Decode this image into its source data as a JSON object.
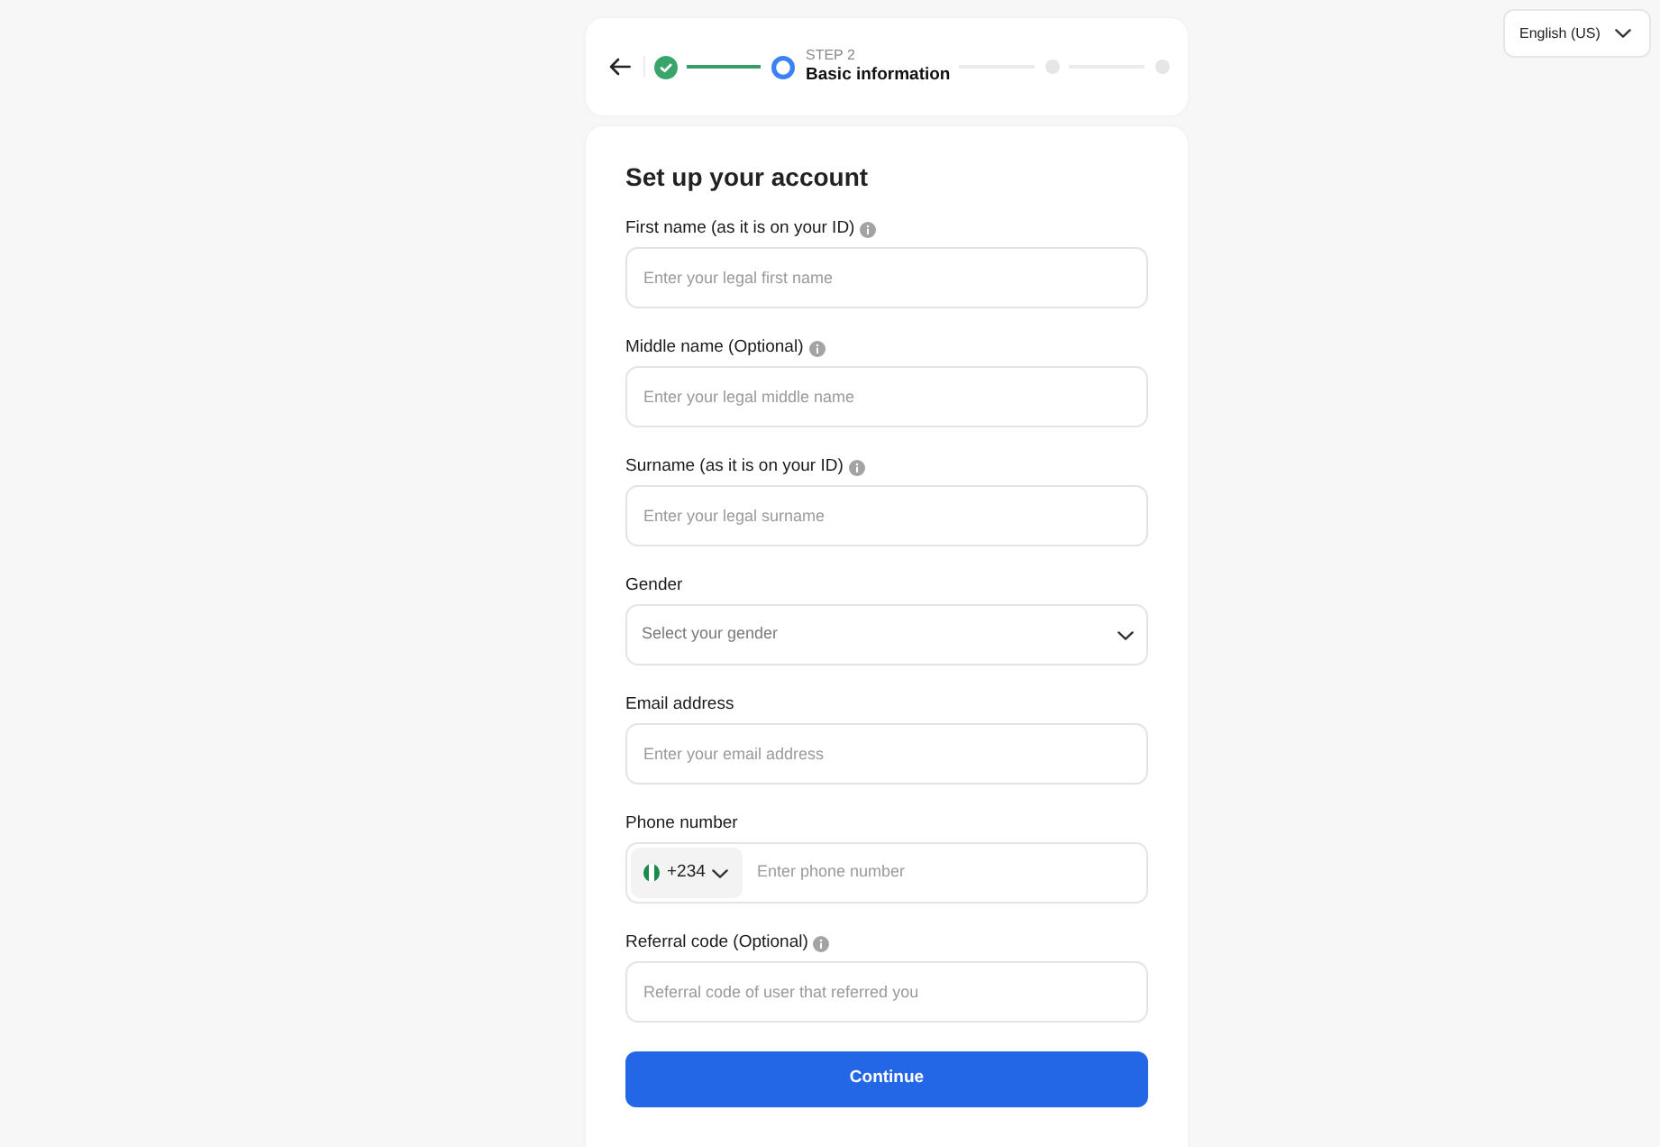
{
  "language_selector": {
    "label": "English (US)"
  },
  "stepper": {
    "steps": [
      {
        "completed": true,
        "current": false
      },
      {
        "completed": false,
        "current": true,
        "caption": "STEP 2",
        "title": "Basic information"
      },
      {
        "completed": false,
        "current": false
      },
      {
        "completed": false,
        "current": false
      }
    ]
  },
  "form": {
    "title": "Set up your account",
    "fields": [
      {
        "kind": "text",
        "label": "First name (as it is on your ID)",
        "info": true,
        "placeholder": "Enter your legal first name"
      },
      {
        "kind": "text",
        "label": "Middle name (Optional)",
        "info": true,
        "placeholder": "Enter your legal middle name"
      },
      {
        "kind": "text",
        "label": "Surname (as it is on your ID)",
        "info": true,
        "placeholder": "Enter your legal surname"
      },
      {
        "kind": "select",
        "label": "Gender",
        "info": false,
        "placeholder": "Select your gender"
      },
      {
        "kind": "text",
        "label": "Email address",
        "info": false,
        "placeholder": "Enter your email address"
      },
      {
        "kind": "phone",
        "label": "Phone number",
        "info": false,
        "country_code": "+234",
        "placeholder": "Enter phone number"
      },
      {
        "kind": "text",
        "label": "Referral code (Optional)",
        "info": true,
        "placeholder": "Referral code of user that referred you"
      }
    ],
    "submit": {
      "label": "Continue"
    }
  }
}
